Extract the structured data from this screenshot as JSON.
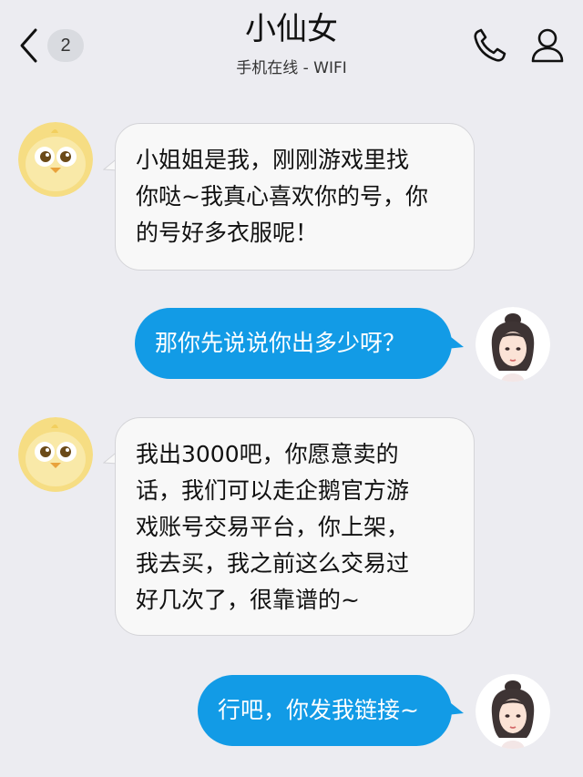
{
  "header": {
    "unread_count": "2",
    "contact_name": "小仙女",
    "status": "手机在线 - WIFI"
  },
  "icons": {
    "back": "back-chevron-icon",
    "call": "phone-icon",
    "profile": "person-icon"
  },
  "colors": {
    "background": "#ececf1",
    "outgoing_bubble": "#129be6",
    "incoming_bubble": "#f8f8f8"
  },
  "messages": [
    {
      "sender": "contact",
      "lines": [
        "小姐姐是我，刚刚游戏里找",
        "你哒~我真心喜欢你的号，你",
        "的号好多衣服呢！"
      ]
    },
    {
      "sender": "me",
      "text": "那你先说说你出多少呀？"
    },
    {
      "sender": "contact",
      "lines": [
        "我出3000吧，你愿意卖的",
        "话，我们可以走企鹅官方游",
        "戏账号交易平台，你上架，",
        "我去买，我之前这么交易过",
        "好几次了，很靠谱的~"
      ]
    },
    {
      "sender": "me",
      "text": "行吧，你发我链接~"
    }
  ]
}
